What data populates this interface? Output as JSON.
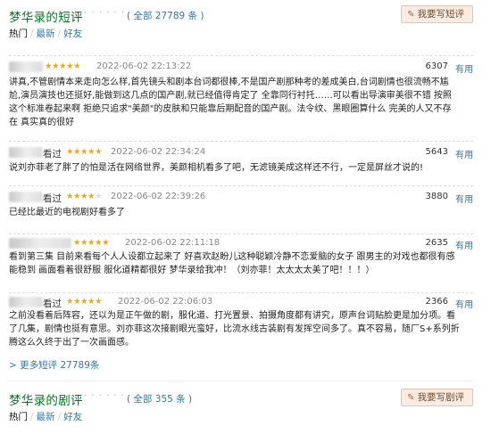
{
  "short_section": {
    "title": "梦华录的短评",
    "dots": "· · · · · ·",
    "count": "( 全部 27789 条 )",
    "write_button": "我要写短评",
    "tabs": {
      "hot": "热门",
      "sep": "/",
      "latest": "最新",
      "friends": "好友"
    }
  },
  "reviews": [
    {
      "user": "",
      "rating": 5,
      "time": "2022-06-02 22:13:22",
      "votes": "6307",
      "useful": "有用",
      "text": "讲真,不管剧情本来走向怎么样,首先镜头和剧本台词都很棒,不是国产剧那种考的差成美白,台词剧情也很流畅不尴尬,演员演技也还挺好,能做到这几点的国产剧,就已经值得肯定了 全靠同行衬托……可以看出导演审美很不错 按照这个标准卷起来啊 拒绝只追求\"美颜\"的皮肤和只能靠后期配音的国产剧。法令纹、黑眼圈算什么 完美的人又不存在 真实真的很好"
    },
    {
      "user": "看过",
      "rating": 5,
      "time": "2022-06-02 22:34:24",
      "votes": "5643",
      "useful": "有用",
      "text": "说刘亦菲老了胖了的怕是活在网络世界，美颜相机看多了吧，无滤镜美成这样还不行，一定是屏丝才说的!"
    },
    {
      "user": "看过",
      "rating": 4,
      "time": "2022-06-02 22:39:26",
      "votes": "3880",
      "useful": "有用",
      "text": "已经比最近的电视剧好看多了"
    },
    {
      "user": "",
      "rating": 5,
      "time": "2022-06-02 22:11:18",
      "votes": "2635",
      "useful": "有用",
      "text": "看到第三集 目前来看每个人人设都立起来了 好喜欢赵盼儿这种聪颖冷静不恋爱脑的女子 跟男主的对戏也都很有感 能稳到 画面看着很舒服 服化道精都很好 梦华录给我冲！（刘亦菲！太太太太美了吧！！！）"
    },
    {
      "user": "看过",
      "rating": 5,
      "time": "2022-06-02 22:06:03",
      "votes": "2366",
      "useful": "有用",
      "text": "之前没看着后阵容，还以为是正午做的剧，服化道、打光置景、拍摄角度都有讲究，原声台词贴脸更是加分项。看了几集，剧情也挺有意思。刘亦菲这次接剧眼光蛮好，比流水线古装剧有发挥空间多了。真不容易，随厂S+系列折腾这么久终于出了一次画面感。"
    }
  ],
  "more_short": "> 更多短评 27789条",
  "long_section": {
    "title": "梦华录的剧评",
    "dots": "· · · · · ·",
    "count": "( 全部 355 条 )",
    "write_button": "我要写剧评",
    "tabs": {
      "hot": "热门",
      "sep": "/",
      "latest": "最新",
      "friends": "好友"
    }
  },
  "colors": {
    "title_green": "#007722",
    "link_blue": "#3377aa",
    "star": "#f3a712",
    "button_bg": "#fbece3"
  }
}
